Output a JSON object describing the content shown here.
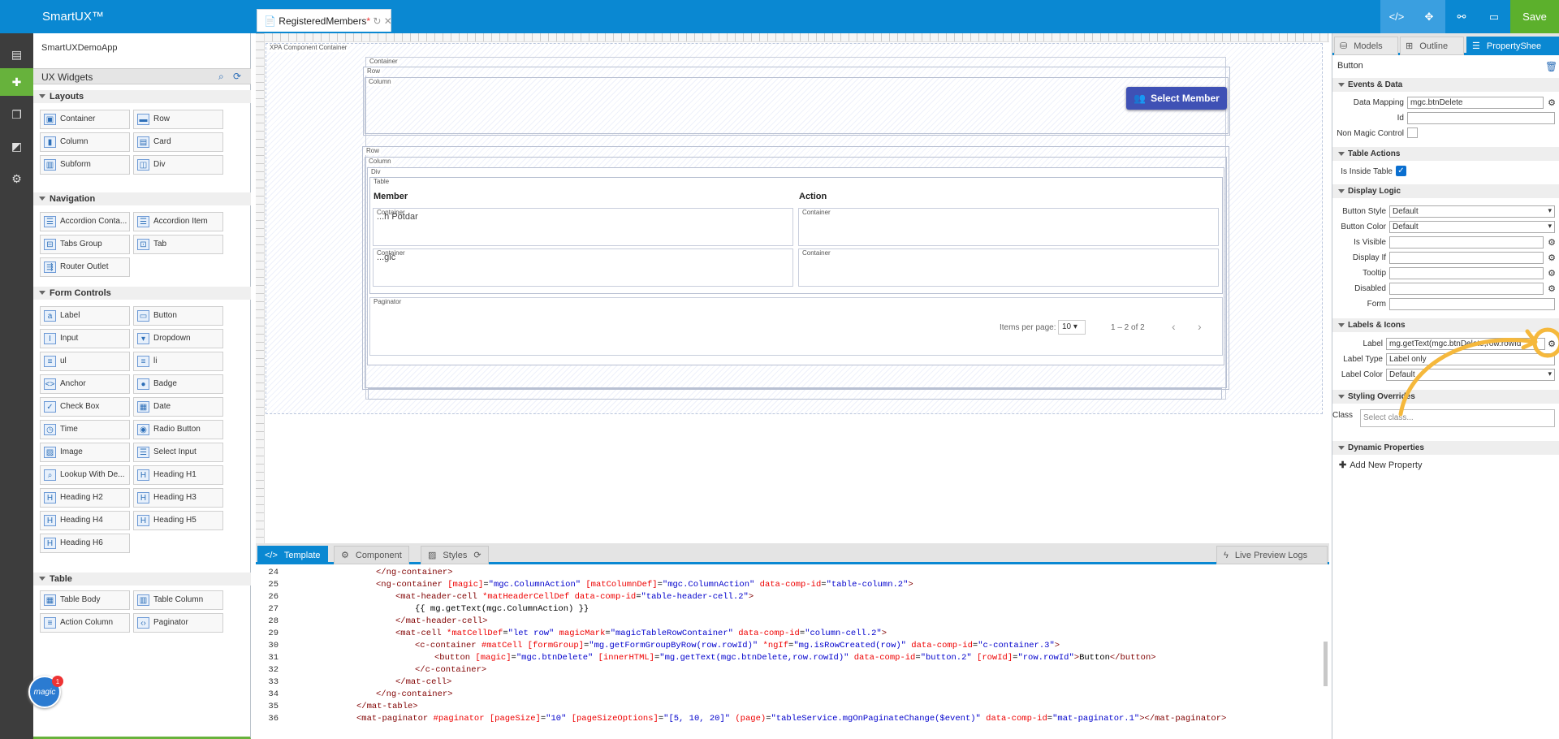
{
  "app": {
    "brand": "SmartUX™",
    "doc_tab": "RegisteredMembers",
    "doc_tab_mark": "*",
    "save": "Save",
    "app_name": "SmartUXDemoApp"
  },
  "palette": {
    "title": "UX Widgets",
    "sections": {
      "layouts": "Layouts",
      "navigation": "Navigation",
      "form_controls": "Form Controls",
      "table": "Table"
    },
    "layouts": [
      "Container",
      "Row",
      "Column",
      "Card",
      "Subform",
      "Div"
    ],
    "navigation": [
      "Accordion Conta...",
      "Accordion Item",
      "Tabs Group",
      "Tab",
      "Router Outlet"
    ],
    "form_controls": [
      "Label",
      "Button",
      "Input",
      "Dropdown",
      "ul",
      "li",
      "Anchor",
      "Badge",
      "Check Box",
      "Date",
      "Time",
      "Radio Button",
      "Image",
      "Select Input",
      "Lookup With De...",
      "Heading H1",
      "Heading H2",
      "Heading H3",
      "Heading H4",
      "Heading H5",
      "Heading H6"
    ],
    "table": [
      "Table Body",
      "Table Column",
      "Action Column",
      "Paginator"
    ],
    "badge_count": "1",
    "badge_text": "magic"
  },
  "canvas": {
    "labels": {
      "xpa": "XPA Component Container",
      "container": "Container",
      "row": "Row",
      "column": "Column",
      "div": "Div",
      "table": "Table",
      "paginator": "Paginator"
    },
    "select_member": "Select Member",
    "table_headers": {
      "member": "Member",
      "action": "Action"
    },
    "rows": [
      {
        "member": "...h Potdar"
      },
      {
        "member": "...gic"
      }
    ],
    "items_per_page_label": "Items per page:",
    "items_per_page": "10",
    "range": "1 – 2 of 2"
  },
  "bottom_tabs": {
    "template": "Template",
    "component": "Component",
    "styles": "Styles",
    "live_preview": "Live Preview Logs"
  },
  "code": [
    {
      "n": "24",
      "indent": 6,
      "parts": [
        [
          "tag",
          "</ng-container>"
        ]
      ]
    },
    {
      "n": "25",
      "indent": 6,
      "parts": [
        [
          "tag",
          "<ng-container "
        ],
        [
          "attr",
          "[magic]"
        ],
        [
          "txt",
          "="
        ],
        [
          "val",
          "\"mgc.ColumnAction\""
        ],
        [
          "txt",
          " "
        ],
        [
          "attr",
          "[matColumnDef]"
        ],
        [
          "txt",
          "="
        ],
        [
          "val",
          "\"mgc.ColumnAction\""
        ],
        [
          "txt",
          " "
        ],
        [
          "attr",
          "data-comp-id"
        ],
        [
          "txt",
          "="
        ],
        [
          "val",
          "\"table-column.2\""
        ],
        [
          "tag",
          ">"
        ]
      ]
    },
    {
      "n": "26",
      "indent": 8,
      "parts": [
        [
          "tag",
          "<mat-header-cell "
        ],
        [
          "attr",
          "*matHeaderCellDef"
        ],
        [
          "txt",
          " "
        ],
        [
          "attr",
          "data-comp-id"
        ],
        [
          "txt",
          "="
        ],
        [
          "val",
          "\"table-header-cell.2\""
        ],
        [
          "tag",
          ">"
        ]
      ]
    },
    {
      "n": "27",
      "indent": 10,
      "parts": [
        [
          "txt",
          "{{ mg.getText(mgc.ColumnAction) }}"
        ]
      ]
    },
    {
      "n": "28",
      "indent": 8,
      "parts": [
        [
          "tag",
          "</mat-header-cell>"
        ]
      ]
    },
    {
      "n": "29",
      "indent": 8,
      "parts": [
        [
          "tag",
          "<mat-cell "
        ],
        [
          "attr",
          "*matCellDef"
        ],
        [
          "txt",
          "="
        ],
        [
          "val",
          "\"let row\""
        ],
        [
          "txt",
          " "
        ],
        [
          "attr",
          "magicMark"
        ],
        [
          "txt",
          "="
        ],
        [
          "val",
          "\"magicTableRowContainer\""
        ],
        [
          "txt",
          " "
        ],
        [
          "attr",
          "data-comp-id"
        ],
        [
          "txt",
          "="
        ],
        [
          "val",
          "\"column-cell.2\""
        ],
        [
          "tag",
          ">"
        ]
      ]
    },
    {
      "n": "30",
      "indent": 10,
      "parts": [
        [
          "tag",
          "<c-container "
        ],
        [
          "attr",
          "#matCell"
        ],
        [
          "txt",
          " "
        ],
        [
          "attr",
          "[formGroup]"
        ],
        [
          "txt",
          "="
        ],
        [
          "val",
          "\"mg.getFormGroupByRow(row.rowId)\""
        ],
        [
          "txt",
          " "
        ],
        [
          "attr",
          "*ngIf"
        ],
        [
          "txt",
          "="
        ],
        [
          "val",
          "\"mg.isRowCreated(row)\""
        ],
        [
          "txt",
          " "
        ],
        [
          "attr",
          "data-comp-id"
        ],
        [
          "txt",
          "="
        ],
        [
          "val",
          "\"c-container.3\""
        ],
        [
          "tag",
          ">"
        ]
      ]
    },
    {
      "n": "31",
      "indent": 12,
      "parts": [
        [
          "tag",
          "<button "
        ],
        [
          "attr",
          "[magic]"
        ],
        [
          "txt",
          "="
        ],
        [
          "val",
          "\"mgc.btnDelete\""
        ],
        [
          "txt",
          " "
        ],
        [
          "attr",
          "[innerHTML]"
        ],
        [
          "txt",
          "="
        ],
        [
          "val",
          "\"mg.getText(mgc.btnDelete,row.rowId)\""
        ],
        [
          "txt",
          " "
        ],
        [
          "attr",
          "data-comp-id"
        ],
        [
          "txt",
          "="
        ],
        [
          "val",
          "\"button.2\""
        ],
        [
          "txt",
          " "
        ],
        [
          "attr",
          "[rowId]"
        ],
        [
          "txt",
          "="
        ],
        [
          "val",
          "\"row.rowId\""
        ],
        [
          "tag",
          ">"
        ],
        [
          "txt",
          "Button"
        ],
        [
          "tag",
          "</button>"
        ]
      ]
    },
    {
      "n": "32",
      "indent": 10,
      "parts": [
        [
          "tag",
          "</c-container>"
        ]
      ]
    },
    {
      "n": "33",
      "indent": 8,
      "parts": [
        [
          "tag",
          "</mat-cell>"
        ]
      ]
    },
    {
      "n": "34",
      "indent": 6,
      "parts": [
        [
          "tag",
          "</ng-container>"
        ]
      ]
    },
    {
      "n": "35",
      "indent": 4,
      "parts": [
        [
          "tag",
          "</mat-table>"
        ]
      ]
    },
    {
      "n": "36",
      "indent": 4,
      "parts": [
        [
          "tag",
          "<mat-paginator "
        ],
        [
          "attr",
          "#paginator"
        ],
        [
          "txt",
          " "
        ],
        [
          "attr",
          "[pageSize]"
        ],
        [
          "txt",
          "="
        ],
        [
          "val",
          "\"10\""
        ],
        [
          "txt",
          " "
        ],
        [
          "attr",
          "[pageSizeOptions]"
        ],
        [
          "txt",
          "="
        ],
        [
          "val",
          "\"[5, 10, 20]\""
        ],
        [
          "txt",
          " "
        ],
        [
          "attr",
          "(page)"
        ],
        [
          "txt",
          "="
        ],
        [
          "val",
          "\"tableService.mgOnPaginateChange($event)\""
        ],
        [
          "txt",
          " "
        ],
        [
          "attr",
          "data-comp-id"
        ],
        [
          "txt",
          "="
        ],
        [
          "val",
          "\"mat-paginator.1\""
        ],
        [
          "tag",
          "></mat-paginator>"
        ]
      ]
    }
  ],
  "props": {
    "tabs": {
      "models": "Models",
      "outline": "Outline",
      "property_sheet": "PropertyShee"
    },
    "title": "Button",
    "sections": {
      "events": "Events & Data",
      "table_actions": "Table Actions",
      "display_logic": "Display Logic",
      "labels_icons": "Labels & Icons",
      "styling": "Styling Overrides",
      "dynamic": "Dynamic Properties"
    },
    "labels": {
      "data_mapping": "Data Mapping",
      "id": "Id",
      "non_magic": "Non Magic Control",
      "is_inside_table": "Is Inside Table",
      "button_style": "Button Style",
      "button_color": "Button Color",
      "is_visible": "Is Visible",
      "display_if": "Display If",
      "tooltip": "Tooltip",
      "disabled": "Disabled",
      "form": "Form",
      "label": "Label",
      "label_type": "Label Type",
      "label_color": "Label Color",
      "class": "Class"
    },
    "values": {
      "data_mapping": "mgc.btnDelete",
      "button_style": "Default",
      "button_color": "Default",
      "label": "mg.getText(mgc.btnDelete,row.rowId",
      "label_type": "Label only",
      "label_color": "Default",
      "class_placeholder": "Select class...",
      "is_inside_table": true
    },
    "add_property": "Add New Property"
  },
  "colors": {
    "accent": "#0a88d2",
    "save": "#5cb02c",
    "select_member": "#3f51b5",
    "annotation": "#f5b83c"
  }
}
